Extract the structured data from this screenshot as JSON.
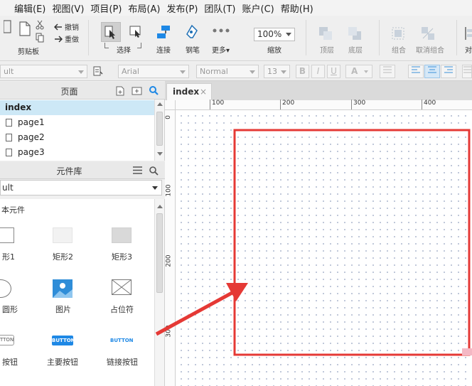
{
  "menu": [
    "编辑(E)",
    "视图(V)",
    "项目(P)",
    "布局(A)",
    "发布(P)",
    "团队(T)",
    "账户(C)",
    "帮助(H)"
  ],
  "toolbar": {
    "clipboard_label": "剪贴板",
    "undo_label": "撤销",
    "redo_label": "重做",
    "select_label": "选择",
    "connect_label": "连接",
    "pen_label": "钢笔",
    "more_label": "更多▾",
    "zoom_value": "100%",
    "zoom_label": "缩放",
    "top_label": "顶层",
    "bottom_label": "底层",
    "group_label": "组合",
    "ungroup_label": "取消组合",
    "align_label": "对"
  },
  "format": {
    "style_value": "ult",
    "font_value": "Arial",
    "weight_value": "Normal",
    "size_value": "13",
    "bold": "B",
    "italic": "I",
    "underline": "U",
    "color": "A"
  },
  "pages": {
    "title": "页面",
    "items": [
      "index",
      "page1",
      "page2",
      "page3"
    ]
  },
  "library": {
    "title": "元件库",
    "selected": "ult",
    "section": "本元件",
    "widgets": [
      "形1",
      "矩形2",
      "矩形3",
      "圆形",
      "图片",
      "占位符",
      "按钮",
      "主要按钮",
      "链接按钮"
    ],
    "button_text": "BUTTON",
    "button_text_partial": "TTON"
  },
  "canvas": {
    "tab": "index",
    "tab_close": "×",
    "ruler_h": [
      "100",
      "200",
      "300",
      "400"
    ],
    "ruler_v": [
      "0",
      "100",
      "200",
      "300"
    ]
  },
  "colors": {
    "accent": "#1e88e5",
    "selected_row": "#cde8f6",
    "annotation_red": "#e53935"
  }
}
